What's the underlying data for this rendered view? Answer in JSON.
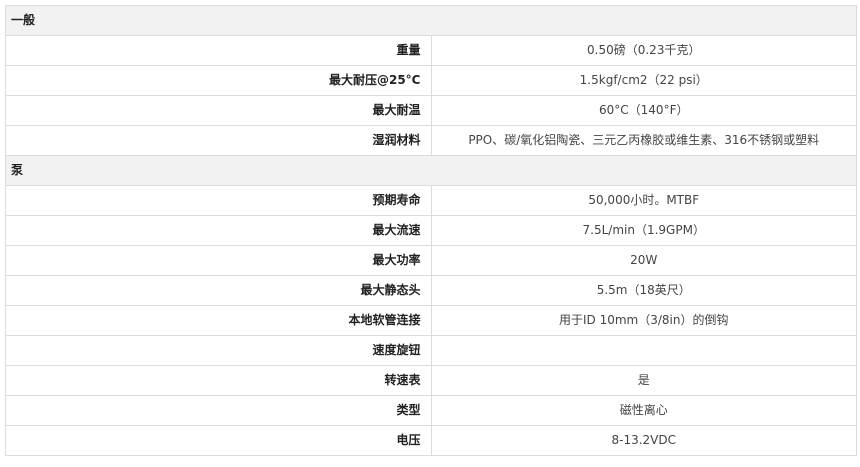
{
  "sections": [
    {
      "title": "一般",
      "rows": [
        {
          "label": "重量",
          "value": "0.50磅（0.23千克）"
        },
        {
          "label": "最大耐压@25°C",
          "value": "1.5kgf/cm2（22 psi）"
        },
        {
          "label": "最大耐温",
          "value": "60°C（140°F）"
        },
        {
          "label": "湿润材料",
          "value": "PPO、碳/氧化铝陶瓷、三元乙丙橡胶或维生素、316不锈钢或塑料"
        }
      ]
    },
    {
      "title": "泵",
      "rows": [
        {
          "label": "预期寿命",
          "value": "50,000小时。MTBF"
        },
        {
          "label": "最大流速",
          "value": "7.5L/min（1.9GPM）"
        },
        {
          "label": "最大功率",
          "value": "20W"
        },
        {
          "label": "最大静态头",
          "value": "5.5m（18英尺）"
        },
        {
          "label": "本地软管连接",
          "value": "用于ID 10mm（3/8in）的倒钩"
        },
        {
          "label": "速度旋钮",
          "value": ""
        },
        {
          "label": "转速表",
          "value": "是"
        },
        {
          "label": "类型",
          "value": "磁性离心"
        },
        {
          "label": "电压",
          "value": "8-13.2VDC"
        }
      ]
    }
  ]
}
